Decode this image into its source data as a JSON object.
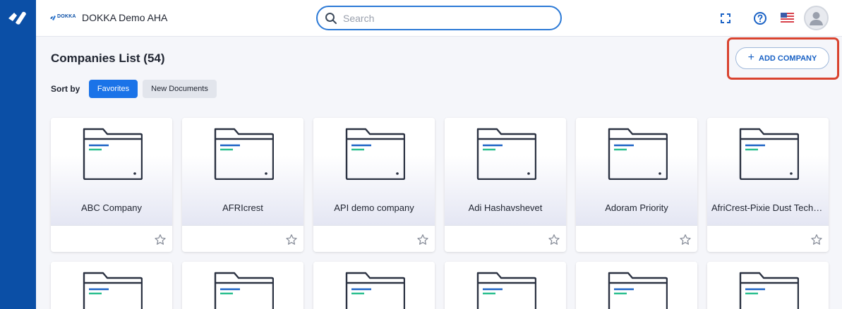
{
  "topbar": {
    "brand_word": "DOKKA",
    "company_name": "DOKKA Demo AHA",
    "search_placeholder": "Search"
  },
  "main": {
    "title": "Companies List (54)",
    "sort_label": "Sort by",
    "sort_options": [
      "Favorites",
      "New Documents"
    ],
    "add_company_label": "ADD COMPANY"
  },
  "companies": [
    {
      "name": "ABC Company",
      "favorite": false
    },
    {
      "name": "AFRIcrest",
      "favorite": false
    },
    {
      "name": "API demo company",
      "favorite": false
    },
    {
      "name": "Adi Hashavshevet",
      "favorite": false
    },
    {
      "name": "Adoram Priority",
      "favorite": false
    },
    {
      "name": "AfriCrest-Pixie Dust Technologies",
      "favorite": false
    }
  ],
  "colors": {
    "sidebar": "#0b4fa6",
    "accent": "#1a73e8",
    "highlight": "#d9432f"
  }
}
